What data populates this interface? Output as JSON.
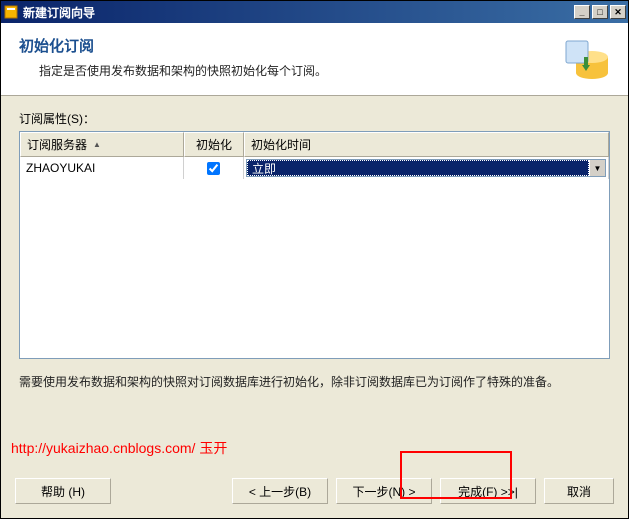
{
  "titlebar": {
    "title": "新建订阅向导"
  },
  "header": {
    "title": "初始化订阅",
    "subtitle": "指定是否使用发布数据和架构的快照初始化每个订阅。"
  },
  "section_label": "订阅属性(S)：",
  "grid": {
    "columns": {
      "server": "订阅服务器",
      "init": "初始化",
      "time": "初始化时间"
    },
    "row": {
      "server": "ZHAOYUKAI",
      "init_checked": true,
      "time_value": "立即"
    }
  },
  "note": "需要使用发布数据和架构的快照对订阅数据库进行初始化，除非订阅数据库已为订阅作了特殊的准备。",
  "link": {
    "url": "http://yukaizhao.cnblogs.com/",
    "author": "玉开"
  },
  "buttons": {
    "help": "帮助 (H)",
    "back": "< 上一步(B)",
    "next": "下一步(N) >",
    "finish": "完成(F) >>|",
    "cancel": "取消"
  }
}
